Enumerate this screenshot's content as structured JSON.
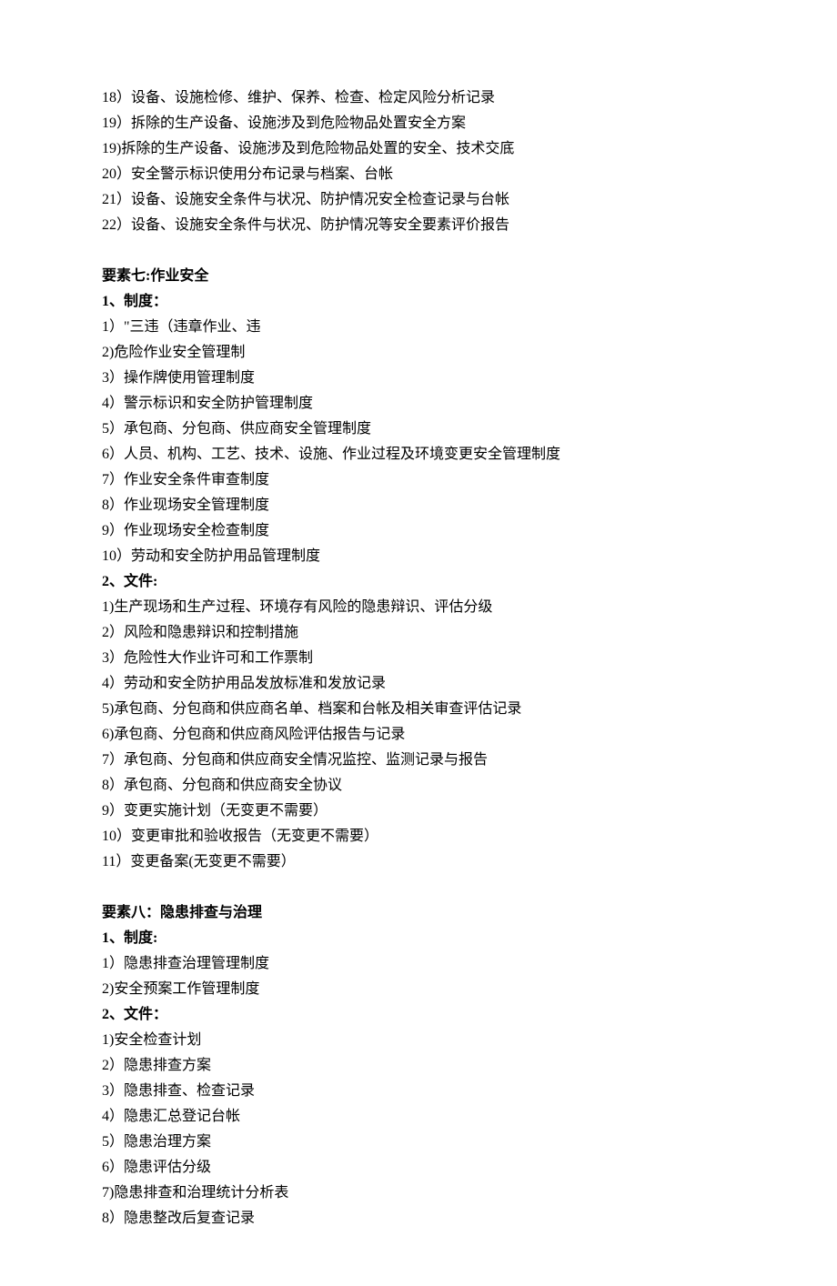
{
  "topItems": [
    "18）设备、设施检修、维护、保养、检查、检定风险分析记录",
    "19）拆除的生产设备、设施涉及到危险物品处置安全方案",
    "19)拆除的生产设备、设施涉及到危险物品处置的安全、技术交底",
    "20）安全警示标识使用分布记录与档案、台帐",
    "21）设备、设施安全条件与状况、防护情况安全检查记录与台帐",
    "22）设备、设施安全条件与状况、防护情况等安全要素评价报告"
  ],
  "section7": {
    "title": "要素七:作业安全",
    "sub1": "1、制度：",
    "items1": [
      "1）\"三违（违章作业、违",
      "2)危险作业安全管理制",
      "3）操作牌使用管理制度",
      "4）警示标识和安全防护管理制度",
      "5）承包商、分包商、供应商安全管理制度",
      "6）人员、机构、工艺、技术、设施、作业过程及环境变更安全管理制度",
      "7）作业安全条件审查制度",
      "8）作业现场安全管理制度",
      "9）作业现场安全检查制度",
      "10）劳动和安全防护用品管理制度"
    ],
    "sub2": "2、文件:",
    "items2": [
      "1)生产现场和生产过程、环境存有风险的隐患辩识、评估分级",
      "2）风险和隐患辩识和控制措施",
      "3）危险性大作业许可和工作票制",
      "4）劳动和安全防护用品发放标准和发放记录",
      "5)承包商、分包商和供应商名单、档案和台帐及相关审查评估记录",
      "6)承包商、分包商和供应商风险评估报告与记录",
      "7）承包商、分包商和供应商安全情况监控、监测记录与报告",
      "8）承包商、分包商和供应商安全协议",
      "9）变更实施计划（无变更不需要）",
      "10）变更审批和验收报告（无变更不需要）",
      "11）变更备案(无变更不需要）"
    ]
  },
  "section8": {
    "title": "要素八：隐患排查与治理",
    "sub1": "1、制度:",
    "items1": [
      "1）隐患排查治理管理制度",
      "2)安全预案工作管理制度"
    ],
    "sub2": "2、文件：",
    "items2": [
      "1)安全检查计划",
      "2）隐患排查方案",
      "3）隐患排查、检查记录",
      "4）隐患汇总登记台帐",
      "5）隐患治理方案",
      "6）隐患评估分级",
      "7)隐患排查和治理统计分析表",
      "8）隐患整改后复查记录"
    ]
  }
}
